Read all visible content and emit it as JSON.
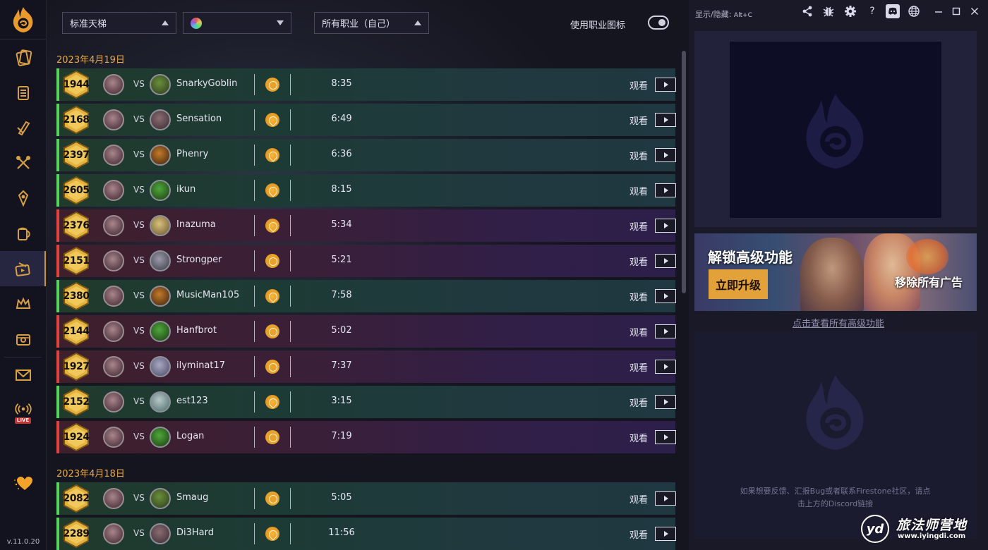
{
  "nav": {
    "items": [
      {
        "name": "collection",
        "icon": "card-collection-icon"
      },
      {
        "name": "decktracker",
        "icon": "deck-icon"
      },
      {
        "name": "battlegrounds",
        "icon": "battlegrounds-icon"
      },
      {
        "name": "mercenaries",
        "icon": "crossed-axes-icon"
      },
      {
        "name": "duels",
        "icon": "duels-icon"
      },
      {
        "name": "arena",
        "icon": "tavern-mug-icon"
      },
      {
        "name": "replays",
        "icon": "replays-icon",
        "active": true
      },
      {
        "name": "achievements",
        "icon": "crown-icon"
      },
      {
        "name": "stats",
        "icon": "stats-chest-icon"
      },
      {
        "name": "mailbox",
        "icon": "mail-icon"
      },
      {
        "name": "streams",
        "icon": "live-stream-icon"
      }
    ],
    "live_label": "LIVE",
    "support_icon": "heart-icon",
    "version": "v.11.0.20"
  },
  "filters": {
    "mode": "标准天梯",
    "hero": "",
    "class": "所有职业（自己）",
    "toggle_label": "使用职业图标",
    "toggle_on": true
  },
  "replays": [
    {
      "date": "2023年4月19日",
      "games": [
        {
          "result": "win",
          "rank": "1944",
          "opponent": "SnarkyGoblin",
          "coin": "coin",
          "duration": "8:35"
        },
        {
          "result": "win",
          "rank": "2168",
          "opponent": "Sensation",
          "coin": "first",
          "duration": "6:49"
        },
        {
          "result": "win",
          "rank": "2397",
          "opponent": "Phenry",
          "coin": "first",
          "duration": "6:36"
        },
        {
          "result": "win",
          "rank": "2605",
          "opponent": "ikun",
          "coin": "first",
          "duration": "8:15"
        },
        {
          "result": "loss",
          "rank": "2376",
          "opponent": "Inazuma",
          "coin": "first",
          "duration": "5:34"
        },
        {
          "result": "loss",
          "rank": "2151",
          "opponent": "Strongper",
          "coin": "coin",
          "duration": "5:21"
        },
        {
          "result": "win",
          "rank": "2380",
          "opponent": "MusicMan105",
          "coin": "first",
          "duration": "7:58"
        },
        {
          "result": "loss",
          "rank": "2144",
          "opponent": "Hanfbrot",
          "coin": "coin",
          "duration": "5:02"
        },
        {
          "result": "loss",
          "rank": "1927",
          "opponent": "ilyminat17",
          "coin": "coin",
          "duration": "7:37"
        },
        {
          "result": "win",
          "rank": "2152",
          "opponent": "est123",
          "coin": "first",
          "duration": "3:15"
        },
        {
          "result": "loss",
          "rank": "1924",
          "opponent": "Logan",
          "coin": "coin",
          "duration": "7:19"
        }
      ]
    },
    {
      "date": "2023年4月18日",
      "games": [
        {
          "result": "win",
          "rank": "2082",
          "opponent": "Smaug",
          "coin": "coin",
          "duration": "5:05"
        },
        {
          "result": "win",
          "rank": "2289",
          "opponent": "Di3Hard",
          "coin": "first",
          "duration": "11:56"
        }
      ]
    }
  ],
  "labels": {
    "vs": "VS",
    "watch": "观看"
  },
  "titlebar": {
    "hotkey_label": "显示/隐藏:",
    "hotkey": "Alt+C",
    "icons": [
      "share-icon",
      "bug-icon",
      "settings-icon",
      "help-icon",
      "discord-icon",
      "globe-icon",
      "minimize-icon",
      "maximize-icon",
      "close-icon"
    ]
  },
  "premium": {
    "headline": "解锁高级功能",
    "upgrade_button": "立即升级",
    "no_ads": "移除所有广告",
    "link": "点击查看所有高级功能"
  },
  "feedback": "如果想要反馈、汇报Bug或者联系Firestone社区，请点击上方的Discord链接",
  "watermark": {
    "logo": "yd",
    "title": "旅法师营地",
    "url": "www.iyingdi.com"
  },
  "colors": {
    "accent": "#e8a94a",
    "win": "#56d45c",
    "loss": "#e0433e",
    "upgrade": "#e3a13a"
  }
}
